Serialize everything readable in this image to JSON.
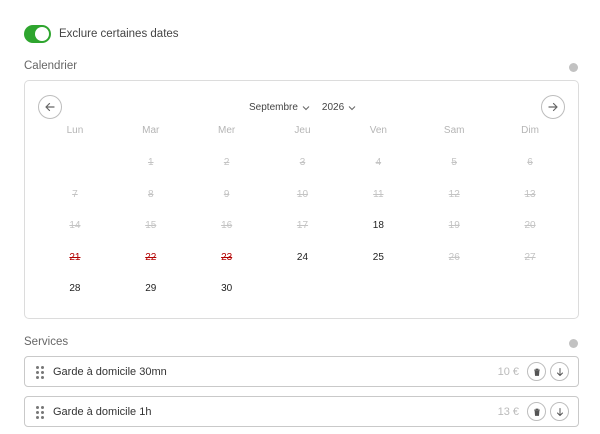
{
  "toggle": {
    "label": "Exclure certaines dates",
    "checked": true,
    "color": "#2ea52e"
  },
  "calendar": {
    "section_label": "Calendrier",
    "month": "Septembre",
    "year": "2026",
    "weekdays": [
      "Lun",
      "Mar",
      "Mer",
      "Jeu",
      "Ven",
      "Sam",
      "Dim"
    ],
    "days": [
      {
        "label": "",
        "state": "empty"
      },
      {
        "label": "1",
        "state": "disabled"
      },
      {
        "label": "2",
        "state": "disabled"
      },
      {
        "label": "3",
        "state": "disabled"
      },
      {
        "label": "4",
        "state": "disabled"
      },
      {
        "label": "5",
        "state": "disabled"
      },
      {
        "label": "6",
        "state": "disabled"
      },
      {
        "label": "7",
        "state": "disabled"
      },
      {
        "label": "8",
        "state": "disabled"
      },
      {
        "label": "9",
        "state": "disabled"
      },
      {
        "label": "10",
        "state": "disabled"
      },
      {
        "label": "11",
        "state": "disabled"
      },
      {
        "label": "12",
        "state": "disabled"
      },
      {
        "label": "13",
        "state": "disabled"
      },
      {
        "label": "14",
        "state": "disabled"
      },
      {
        "label": "15",
        "state": "disabled"
      },
      {
        "label": "16",
        "state": "disabled"
      },
      {
        "label": "17",
        "state": "disabled"
      },
      {
        "label": "18",
        "state": "available"
      },
      {
        "label": "19",
        "state": "disabled"
      },
      {
        "label": "20",
        "state": "disabled"
      },
      {
        "label": "21",
        "state": "excluded"
      },
      {
        "label": "22",
        "state": "excluded"
      },
      {
        "label": "23",
        "state": "excluded"
      },
      {
        "label": "24",
        "state": "available"
      },
      {
        "label": "25",
        "state": "available"
      },
      {
        "label": "26",
        "state": "disabled"
      },
      {
        "label": "27",
        "state": "disabled"
      },
      {
        "label": "28",
        "state": "available"
      },
      {
        "label": "29",
        "state": "available"
      },
      {
        "label": "30",
        "state": "available"
      }
    ],
    "excluded_color": "#b30000"
  },
  "services": {
    "section_label": "Services",
    "items": [
      {
        "name": "Garde à domicile 30mn",
        "price": "10 €"
      },
      {
        "name": "Garde à domicile 1h",
        "price": "13 €"
      }
    ]
  }
}
